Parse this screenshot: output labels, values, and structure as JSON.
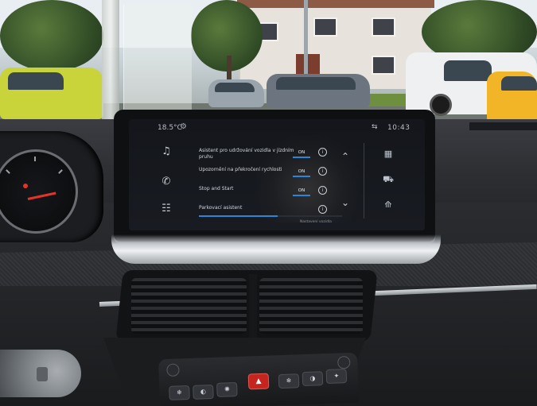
{
  "screen": {
    "status": {
      "temperature": "18.5°C",
      "fan_icon": "fan-icon",
      "right_icon": "connectivity-icon",
      "time": "10:43"
    },
    "left_rail": [
      {
        "icon": "music-icon",
        "glyph": "♫"
      },
      {
        "icon": "phone-icon",
        "glyph": "✆"
      },
      {
        "icon": "apps-icon",
        "glyph": "☷"
      }
    ],
    "settings": [
      {
        "label": "Asistent pro udržování vozidla v jízdním pruhu",
        "toggle": "ON"
      },
      {
        "label": "Upozornění na překročení rychlosti",
        "toggle": "ON"
      },
      {
        "label": "Stop and Start",
        "toggle": "ON"
      },
      {
        "label": "Parkovací asistent",
        "toggle": ""
      }
    ],
    "info_glyph": "i",
    "scroll_up": "⌃",
    "scroll_down": "⌄",
    "side_icons": [
      {
        "icon": "grid-icon",
        "glyph": "▦"
      },
      {
        "icon": "car-icon",
        "glyph": "⛟"
      },
      {
        "icon": "navigation-icon",
        "glyph": "⟰"
      }
    ],
    "progress": 0.55,
    "caption": "Nastavení vozidla"
  },
  "controls": {
    "hazard_glyph": "▲",
    "buttons": [
      "❄",
      "◐",
      "✺",
      "❄",
      "◑",
      "✦",
      "⇊"
    ]
  },
  "colors": {
    "accent": "#2c86d8",
    "hazard": "#c6241f",
    "needle": "#e4332a"
  }
}
